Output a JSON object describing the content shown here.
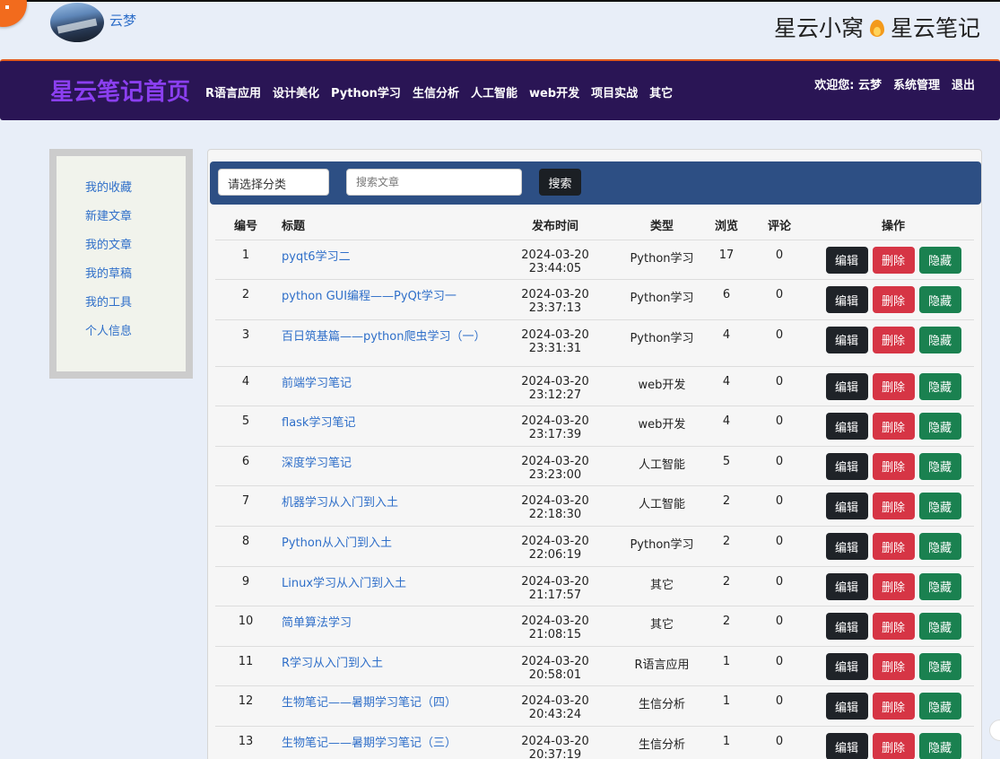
{
  "header": {
    "user_name": "云梦",
    "brand_left": "星云小窝",
    "brand_right": "星云笔记",
    "fire_icon": "fire-icon"
  },
  "navbar": {
    "brand": "星云笔记首页",
    "menu": [
      "R语言应用",
      "设计美化",
      "Python学习",
      "生信分析",
      "人工智能",
      "web开发",
      "项目实战",
      "其它"
    ],
    "welcome": "欢迎您: 云梦",
    "admin": "系统管理",
    "logout": "退出"
  },
  "sidebar": {
    "items": [
      "我的收藏",
      "新建文章",
      "我的文章",
      "我的草稿",
      "我的工具",
      "个人信息"
    ]
  },
  "toolbar": {
    "category_placeholder": "请选择分类",
    "search_placeholder": "搜索文章",
    "search_label": "搜索"
  },
  "table": {
    "headers": [
      "编号",
      "标题",
      "发布时间",
      "类型",
      "浏览",
      "评论",
      "操作"
    ],
    "buttons": {
      "edit": "编辑",
      "delete": "删除",
      "hide": "隐藏"
    },
    "rows": [
      {
        "id": "1",
        "title": "pyqt6学习二",
        "time": "2024-03-20 23:44:05",
        "type": "Python学习",
        "views": "17",
        "comments": "0"
      },
      {
        "id": "2",
        "title": "python GUI编程——PyQt学习一",
        "time": "2024-03-20 23:37:13",
        "type": "Python学习",
        "views": "6",
        "comments": "0"
      },
      {
        "id": "3",
        "title": "百日筑基篇——python爬虫学习（一）",
        "time": "2024-03-20 23:31:31",
        "type": "Python学习",
        "views": "4",
        "comments": "0"
      },
      {
        "id": "4",
        "title": "前端学习笔记",
        "time": "2024-03-20 23:12:27",
        "type": "web开发",
        "views": "4",
        "comments": "0"
      },
      {
        "id": "5",
        "title": "flask学习笔记",
        "time": "2024-03-20 23:17:39",
        "type": "web开发",
        "views": "4",
        "comments": "0"
      },
      {
        "id": "6",
        "title": "深度学习笔记",
        "time": "2024-03-20 23:23:00",
        "type": "人工智能",
        "views": "5",
        "comments": "0"
      },
      {
        "id": "7",
        "title": "机器学习从入门到入土",
        "time": "2024-03-20 22:18:30",
        "type": "人工智能",
        "views": "2",
        "comments": "0"
      },
      {
        "id": "8",
        "title": "Python从入门到入土",
        "time": "2024-03-20 22:06:19",
        "type": "Python学习",
        "views": "2",
        "comments": "0"
      },
      {
        "id": "9",
        "title": "Linux学习从入门到入土",
        "time": "2024-03-20 21:17:57",
        "type": "其它",
        "views": "2",
        "comments": "0"
      },
      {
        "id": "10",
        "title": "简单算法学习",
        "time": "2024-03-20 21:08:15",
        "type": "其它",
        "views": "2",
        "comments": "0"
      },
      {
        "id": "11",
        "title": "R学习从入门到入土",
        "time": "2024-03-20 20:58:01",
        "type": "R语言应用",
        "views": "1",
        "comments": "0"
      },
      {
        "id": "12",
        "title": "生物笔记——暑期学习笔记（四）",
        "time": "2024-03-20 20:43:24",
        "type": "生信分析",
        "views": "1",
        "comments": "0"
      },
      {
        "id": "13",
        "title": "生物笔记——暑期学习笔记（三）",
        "time": "2024-03-20 20:37:19",
        "type": "生信分析",
        "views": "1",
        "comments": "0"
      }
    ]
  },
  "colors": {
    "navbar_bg": "#2a1555",
    "brand_purple": "#8b3ff0",
    "toolbar_bg": "#2d4f84",
    "link_blue": "#2f6fc9",
    "edit_btn": "#1f2328",
    "delete_btn": "#d63545",
    "hide_btn": "#1a8150"
  }
}
